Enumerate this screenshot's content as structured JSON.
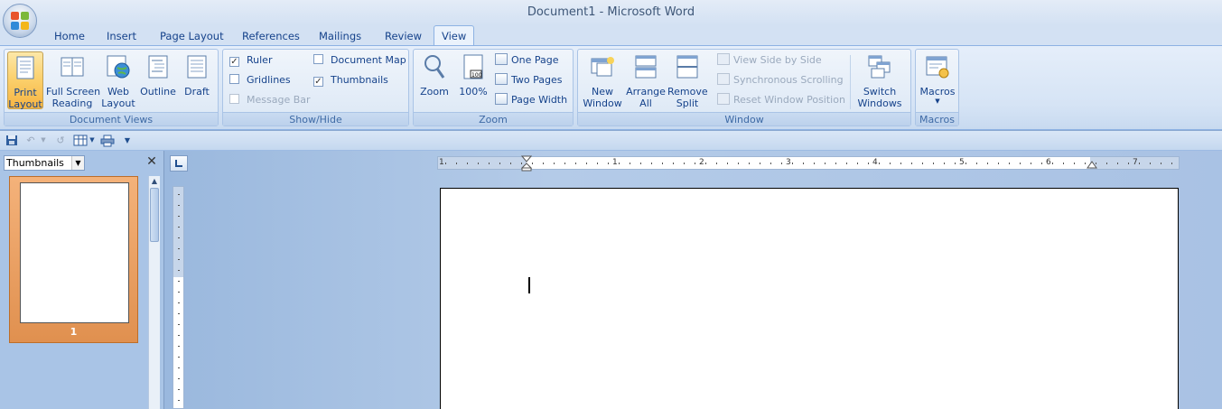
{
  "window": {
    "title": "Document1 - Microsoft Word"
  },
  "tabs": [
    "Home",
    "Insert",
    "Page Layout",
    "References",
    "Mailings",
    "Review",
    "View"
  ],
  "active_tab": "View",
  "ribbon": {
    "document_views": {
      "label": "Document Views",
      "print_layout": "Print\nLayout",
      "full_screen_reading": "Full Screen\nReading",
      "web_layout": "Web\nLayout",
      "outline": "Outline",
      "draft": "Draft"
    },
    "show_hide": {
      "label": "Show/Hide",
      "ruler": "Ruler",
      "gridlines": "Gridlines",
      "message_bar": "Message Bar",
      "document_map": "Document Map",
      "thumbnails": "Thumbnails",
      "ruler_checked": true,
      "gridlines_checked": false,
      "document_map_checked": false,
      "thumbnails_checked": true
    },
    "zoom": {
      "label": "Zoom",
      "zoom": "Zoom",
      "hundred": "100%",
      "one_page": "One Page",
      "two_pages": "Two Pages",
      "page_width": "Page Width"
    },
    "window_group": {
      "label": "Window",
      "new_window": "New\nWindow",
      "arrange_all": "Arrange\nAll",
      "remove_split": "Remove\nSplit",
      "view_side_by_side": "View Side by Side",
      "synchronous_scrolling": "Synchronous Scrolling",
      "reset_window_position": "Reset Window Position",
      "switch_windows": "Switch\nWindows"
    },
    "macros": {
      "label": "Macros",
      "macros": "Macros"
    }
  },
  "thumbnail_pane": {
    "select_value": "Thumbnails",
    "page_number": "1"
  },
  "ruler": {
    "numbers": [
      "1",
      "1",
      "2",
      "3",
      "4",
      "5",
      "6",
      "7"
    ]
  },
  "colors": {
    "accent": "#15428b",
    "active_button": "#fbcf6a",
    "thumb_selected": "#e0904f"
  }
}
